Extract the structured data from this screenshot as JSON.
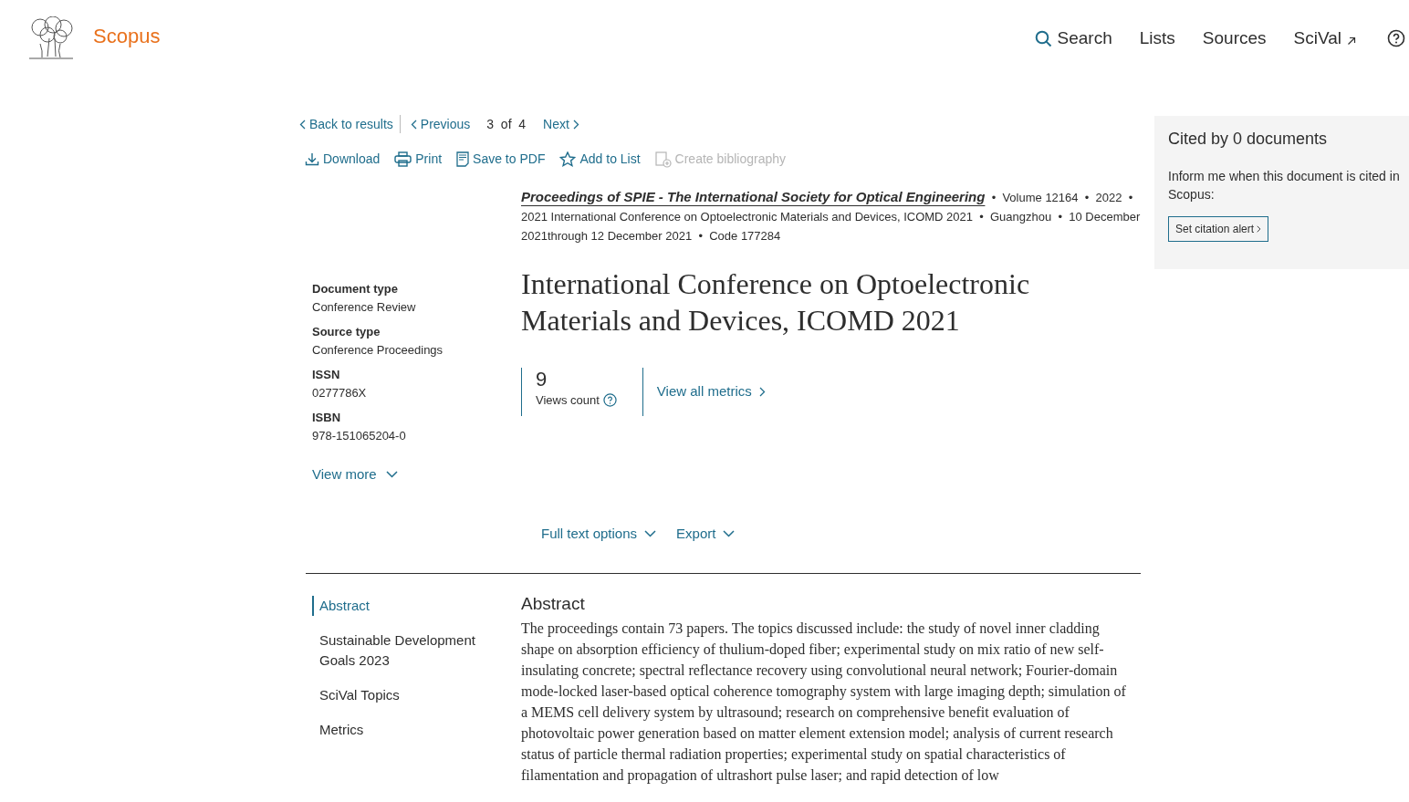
{
  "header": {
    "brand": "Scopus",
    "nav": [
      {
        "label": "Search",
        "kind": "search"
      },
      {
        "label": "Lists",
        "kind": "plain"
      },
      {
        "label": "Sources",
        "kind": "plain"
      },
      {
        "label": "SciVal",
        "kind": "external"
      }
    ]
  },
  "pager": {
    "back": "Back to results",
    "previous": "Previous",
    "current": "3",
    "of": "of",
    "total": "4",
    "next": "Next"
  },
  "actions": [
    {
      "label": "Download",
      "kind": "download",
      "disabled": false
    },
    {
      "label": "Print",
      "kind": "print",
      "disabled": false
    },
    {
      "label": "Save to PDF",
      "kind": "pdf",
      "disabled": false
    },
    {
      "label": "Add to List",
      "kind": "star",
      "disabled": false
    },
    {
      "label": "Create bibliography",
      "kind": "bib",
      "disabled": true
    }
  ],
  "source": {
    "separator": "•",
    "journal": "Proceedings of SPIE - The International Society for Optical Engineering",
    "rest": [
      "Volume 12164",
      "2022",
      "2021 International Conference on Optoelectronic Materials and Devices, ICOMD 2021",
      "Guangzhou",
      "10 December 2021through 12 December 2021",
      "Code 177284"
    ]
  },
  "details": [
    {
      "label": "Document type",
      "value": "Conference Review"
    },
    {
      "label": "Source type",
      "value": "Conference Proceedings"
    },
    {
      "label": "ISSN",
      "value": "0277786X"
    },
    {
      "label": "ISBN",
      "value": "978-151065204-0"
    }
  ],
  "view_more": "View more",
  "title": "International Conference on Optoelectronic Materials and Devices, ICOMD 2021",
  "metrics": {
    "views": "9",
    "views_label": "Views count",
    "all": "View all metrics"
  },
  "full_text": "Full text options",
  "export": "Export",
  "sections": [
    {
      "label": "Abstract",
      "selected": true
    },
    {
      "label": "Sustainable Development Goals 2023",
      "selected": false
    },
    {
      "label": "SciVal Topics",
      "selected": false
    },
    {
      "label": "Metrics",
      "selected": false
    }
  ],
  "abstract": {
    "heading": "Abstract",
    "text": "The proceedings contain 73 papers. The topics discussed include: the study of novel inner cladding shape on absorption efficiency of thulium-doped fiber; experimental study on mix ratio of new self-insulating concrete; spectral reflectance recovery using convolutional neural network; Fourier-domain mode-locked laser-based optical coherence tomography system with large imaging depth; simulation of a MEMS cell delivery system by ultrasound; research on comprehensive benefit evaluation of photovoltaic power generation based on matter element extension model; analysis of current research status of particle thermal radiation properties; experimental study on spatial characteristics of filamentation and propagation of ultrashort pulse laser; and rapid detection of low"
  },
  "cited": {
    "title": "Cited by 0 documents",
    "text": "Inform me when this document is cited in Scopus:",
    "button": "Set citation alert"
  }
}
